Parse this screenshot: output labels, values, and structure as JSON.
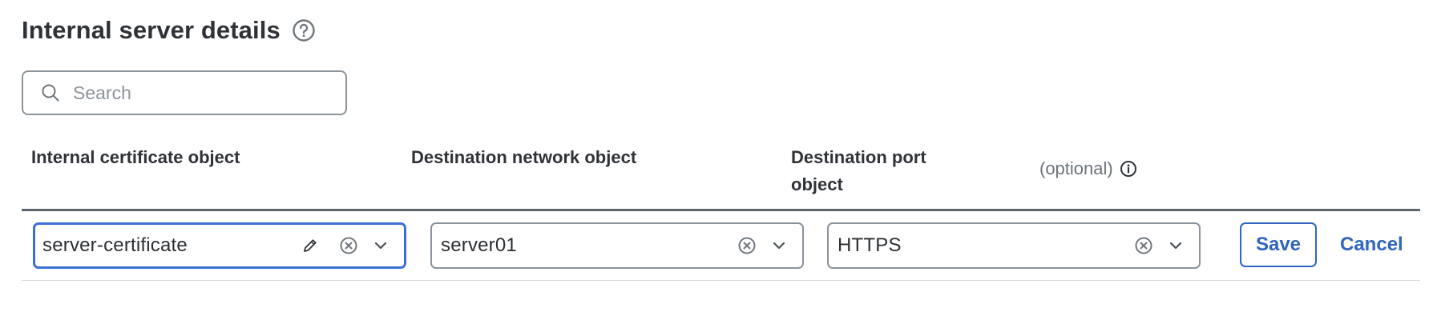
{
  "header": {
    "title": "Internal server details",
    "help_icon": "help-circle-icon"
  },
  "search": {
    "placeholder": "Search",
    "value": "",
    "icon": "search-icon"
  },
  "columns": {
    "cert": "Internal certificate object",
    "network": "Destination network object",
    "port_line1": "Destination port",
    "port_line2": "object",
    "optional": "(optional)",
    "info_icon": "info-icon"
  },
  "row": {
    "certificate": {
      "value": "server-certificate",
      "icons": [
        "pencil-icon",
        "clear-icon",
        "chevron-down-icon"
      ]
    },
    "network": {
      "value": "server01",
      "icons": [
        "clear-icon",
        "chevron-down-icon"
      ]
    },
    "port": {
      "value": "HTTPS",
      "icons": [
        "clear-icon",
        "chevron-down-icon"
      ]
    }
  },
  "actions": {
    "save": "Save",
    "cancel": "Cancel"
  },
  "colors": {
    "accent": "#2f64c1",
    "focus_border": "#3a70d8",
    "border": "#8b939b",
    "text": "#2f3338"
  }
}
